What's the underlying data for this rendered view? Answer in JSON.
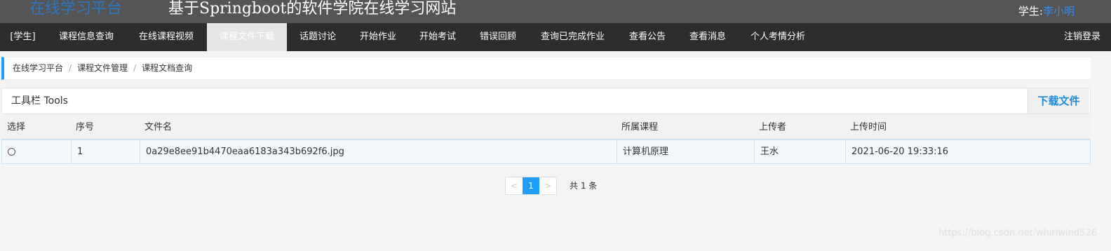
{
  "header": {
    "brand": "在线学习平台",
    "title": "基于Springboot的软件学院在线学习网站",
    "user_prefix": "学生:",
    "user_name": "李小明"
  },
  "nav": {
    "items": [
      {
        "label": "[学生]"
      },
      {
        "label": "课程信息查询"
      },
      {
        "label": "在线课程视频"
      },
      {
        "label": "课程文件下载",
        "active": true
      },
      {
        "label": "话题讨论"
      },
      {
        "label": "开始作业"
      },
      {
        "label": "开始考试"
      },
      {
        "label": "错误回顾"
      },
      {
        "label": "查询已完成作业"
      },
      {
        "label": "查看公告"
      },
      {
        "label": "查看消息"
      },
      {
        "label": "个人考情分析"
      }
    ],
    "logout": "注销登录"
  },
  "breadcrumb": [
    "在线学习平台",
    "课程文件管理",
    "课程文档查询"
  ],
  "toolbar": {
    "title": "工具栏 Tools",
    "download_label": "下载文件"
  },
  "table": {
    "columns": [
      "选择",
      "序号",
      "文件名",
      "所属课程",
      "上传者",
      "上传时间"
    ],
    "rows": [
      {
        "index": "1",
        "filename": "0a29e8ee91b4470eaa6183a343b692f6.jpg",
        "course": "计算机原理",
        "uploader": "王水",
        "upload_time": "2021-06-20 19:33:16"
      }
    ]
  },
  "pager": {
    "prev": "<",
    "current": "1",
    "next": ">",
    "total": "共 1 条"
  },
  "watermark": "https://blog.csdn.net/whirlwind526",
  "colors": {
    "topbar": "#555555",
    "navbar": "#2d2d2d",
    "accent": "#1e9fff",
    "brand": "#2e77c2"
  }
}
